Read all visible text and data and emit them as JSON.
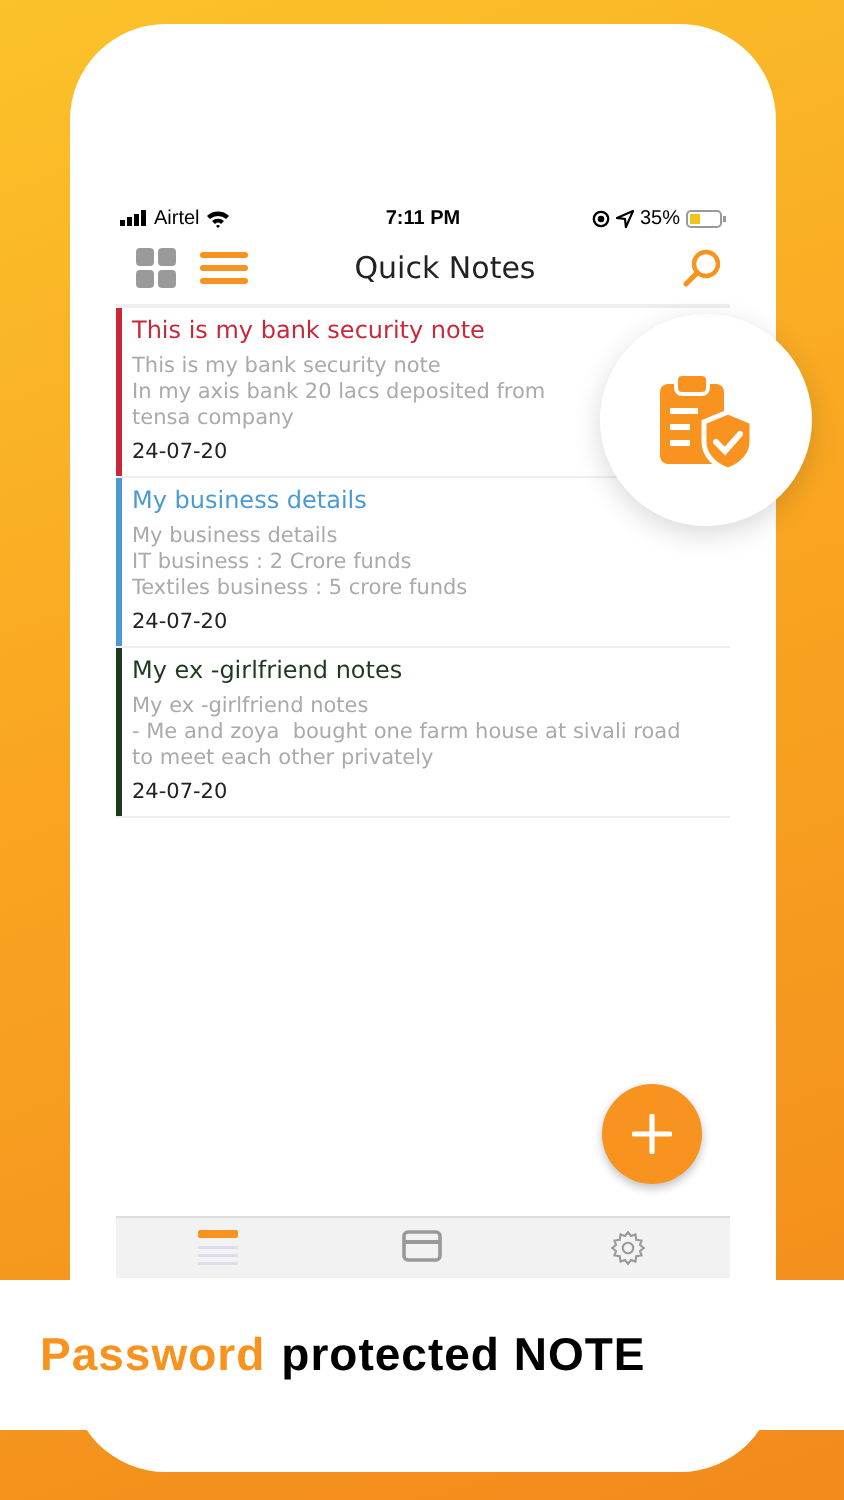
{
  "status_bar": {
    "carrier": "Airtel",
    "time": "7:11 PM",
    "battery": "35%"
  },
  "header": {
    "title": "Quick Notes"
  },
  "notes": [
    {
      "title": "This is my bank security note",
      "body": [
        "This is my bank security note",
        "In my axis bank 20 lacs deposited from",
        "tensa company"
      ],
      "date": "24-07-20",
      "color": "#c8283a"
    },
    {
      "title": "My business details",
      "body": [
        "My business details",
        "IT business : 2 Crore funds",
        "Textiles business : 5 crore funds"
      ],
      "date": "24-07-20",
      "color": "#4a9ad4"
    },
    {
      "title": "My ex -girlfriend notes",
      "body": [
        "My ex -girlfriend notes",
        "- Me and zoya  bought one farm house at sivali road",
        "to meet each other privately"
      ],
      "date": "24-07-20",
      "color": "#1e3a1e"
    }
  ],
  "tab_bar": [
    {
      "kind": "notes",
      "selected": true
    },
    {
      "kind": "card",
      "selected": false
    },
    {
      "kind": "settings",
      "selected": false
    }
  ],
  "caption": {
    "highlight": "Password",
    "rest": "protected NOTE"
  }
}
